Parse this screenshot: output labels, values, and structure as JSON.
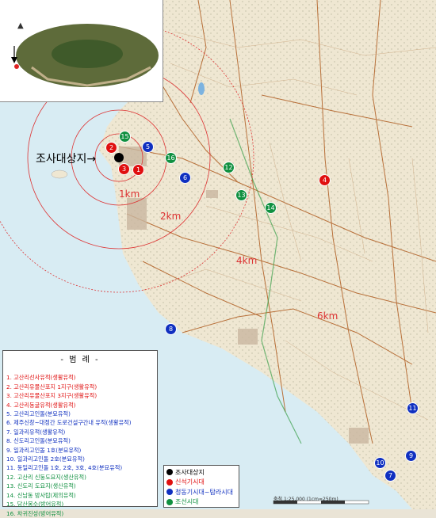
{
  "site_label": "조사대상지",
  "ring_labels": [
    "1km",
    "2km",
    "4km",
    "6km"
  ],
  "legend": {
    "title": "- 범 례 -",
    "items": [
      {
        "text": "1. 고산리선사유적(생활유적)",
        "color": "#e01010"
      },
      {
        "text": "2. 고산리유물산포지 1지구(생활유적)",
        "color": "#e01010"
      },
      {
        "text": "3. 고산리유물산포지 3지구(생활유적)",
        "color": "#e01010"
      },
      {
        "text": "4. 고산리동굴유적(생활유적)",
        "color": "#e01010"
      },
      {
        "text": "5. 고산리고인돌(분묘유적)",
        "color": "#1030c0"
      },
      {
        "text": "6. 제주신창~대정간 도로건설구간내 유적(생활유적)",
        "color": "#1030c0"
      },
      {
        "text": "7. 일과리유적(생활유적)",
        "color": "#1030c0"
      },
      {
        "text": "8. 신도리고인돌(분묘유적)",
        "color": "#1030c0"
      },
      {
        "text": "9. 일과리고인돌 1호(분묘유적)",
        "color": "#1030c0"
      },
      {
        "text": "10. 일과리고인돌 2호(분묘유적)",
        "color": "#1030c0"
      },
      {
        "text": "11. 동일리고인돌 1호, 2호, 3호, 4호(분묘유적)",
        "color": "#1030c0"
      },
      {
        "text": "12. 고산리 신둥도요지(생산유적)",
        "color": "#109040"
      },
      {
        "text": "13. 신도리 도요지(생산유적)",
        "color": "#109040"
      },
      {
        "text": "14. 신남동 방사탑(제의유적)",
        "color": "#109040"
      },
      {
        "text": "15. 당산봉수(방어유적)",
        "color": "#109040"
      },
      {
        "text": "16. 차귀진성(방어유적)",
        "color": "#109040"
      }
    ]
  },
  "periods": [
    {
      "label": "조사대상지",
      "color": "#000000"
    },
    {
      "label": "신석기시대",
      "color": "#e01010"
    },
    {
      "label": "청동기시대~탐라시대",
      "color": "#1030c0"
    },
    {
      "label": "조선시대",
      "color": "#109040"
    }
  ],
  "markers": [
    {
      "num": "1",
      "color": "#e01010"
    },
    {
      "num": "2",
      "color": "#e01010"
    },
    {
      "num": "3",
      "color": "#e01010"
    },
    {
      "num": "4",
      "color": "#e01010"
    },
    {
      "num": "5",
      "color": "#1030c0"
    },
    {
      "num": "6",
      "color": "#1030c0"
    },
    {
      "num": "7",
      "color": "#1030c0"
    },
    {
      "num": "8",
      "color": "#1030c0"
    },
    {
      "num": "9",
      "color": "#1030c0"
    },
    {
      "num": "10",
      "color": "#1030c0"
    },
    {
      "num": "11",
      "color": "#1030c0"
    },
    {
      "num": "12",
      "color": "#109040"
    },
    {
      "num": "13",
      "color": "#109040"
    },
    {
      "num": "14",
      "color": "#109040"
    },
    {
      "num": "15",
      "color": "#109040"
    },
    {
      "num": "16",
      "color": "#109040"
    }
  ],
  "scale_text": "축척 1:25,000 (1cm=250m)"
}
